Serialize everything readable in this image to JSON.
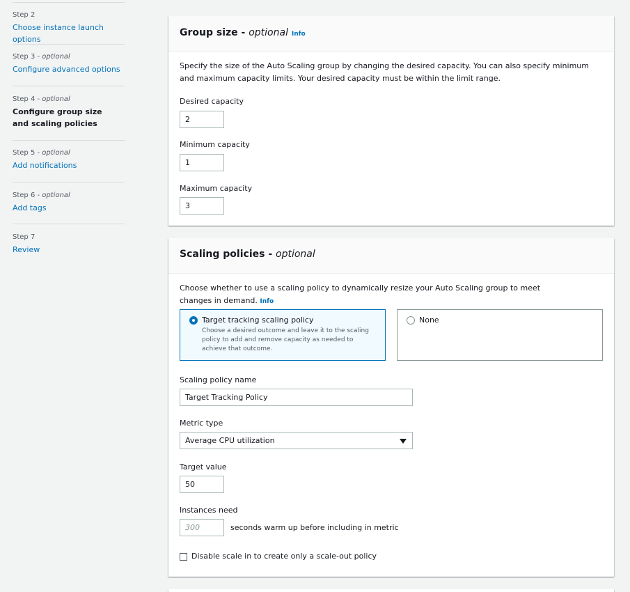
{
  "sidebar": {
    "steps": [
      {
        "label": "Step 2",
        "optional": "",
        "title": "Choose instance launch options"
      },
      {
        "label": "Step 3 - ",
        "optional": "optional",
        "title": "Configure advanced options"
      },
      {
        "label": "Step 4 - ",
        "optional": "optional",
        "title": "Configure group size and scaling policies"
      },
      {
        "label": "Step 5 - ",
        "optional": "optional",
        "title": "Add notifications"
      },
      {
        "label": "Step 6 - ",
        "optional": "optional",
        "title": "Add tags"
      },
      {
        "label": "Step 7",
        "optional": "",
        "title": "Review"
      }
    ]
  },
  "group_size": {
    "title": "Group size - ",
    "title_optional": "optional",
    "info": "Info",
    "description": "Specify the size of the Auto Scaling group by changing the desired capacity. You can also specify minimum and maximum capacity limits. Your desired capacity must be within the limit range.",
    "desired_label": "Desired capacity",
    "desired_value": "2",
    "min_label": "Minimum capacity",
    "min_value": "1",
    "max_label": "Maximum capacity",
    "max_value": "3"
  },
  "scaling": {
    "title": "Scaling policies - ",
    "title_optional": "optional",
    "description": "Choose whether to use a scaling policy to dynamically resize your Auto Scaling group to meet changes in demand.",
    "info": "Info",
    "option_target_title": "Target tracking scaling policy",
    "option_target_desc": "Choose a desired outcome and leave it to the scaling policy to add and remove capacity as needed to achieve that outcome.",
    "option_none_title": "None",
    "policy_name_label": "Scaling policy name",
    "policy_name_value": "Target Tracking Policy",
    "metric_label": "Metric type",
    "metric_value": "Average CPU utilization",
    "target_label": "Target value",
    "target_value": "50",
    "instances_label": "Instances need",
    "warmup_placeholder": "300",
    "warmup_suffix": "seconds warm up before including in metric",
    "disable_scale_in_label": "Disable scale in to create only a scale-out policy"
  },
  "colors": {
    "link": "#0073bb",
    "background": "#f2f3f3"
  }
}
